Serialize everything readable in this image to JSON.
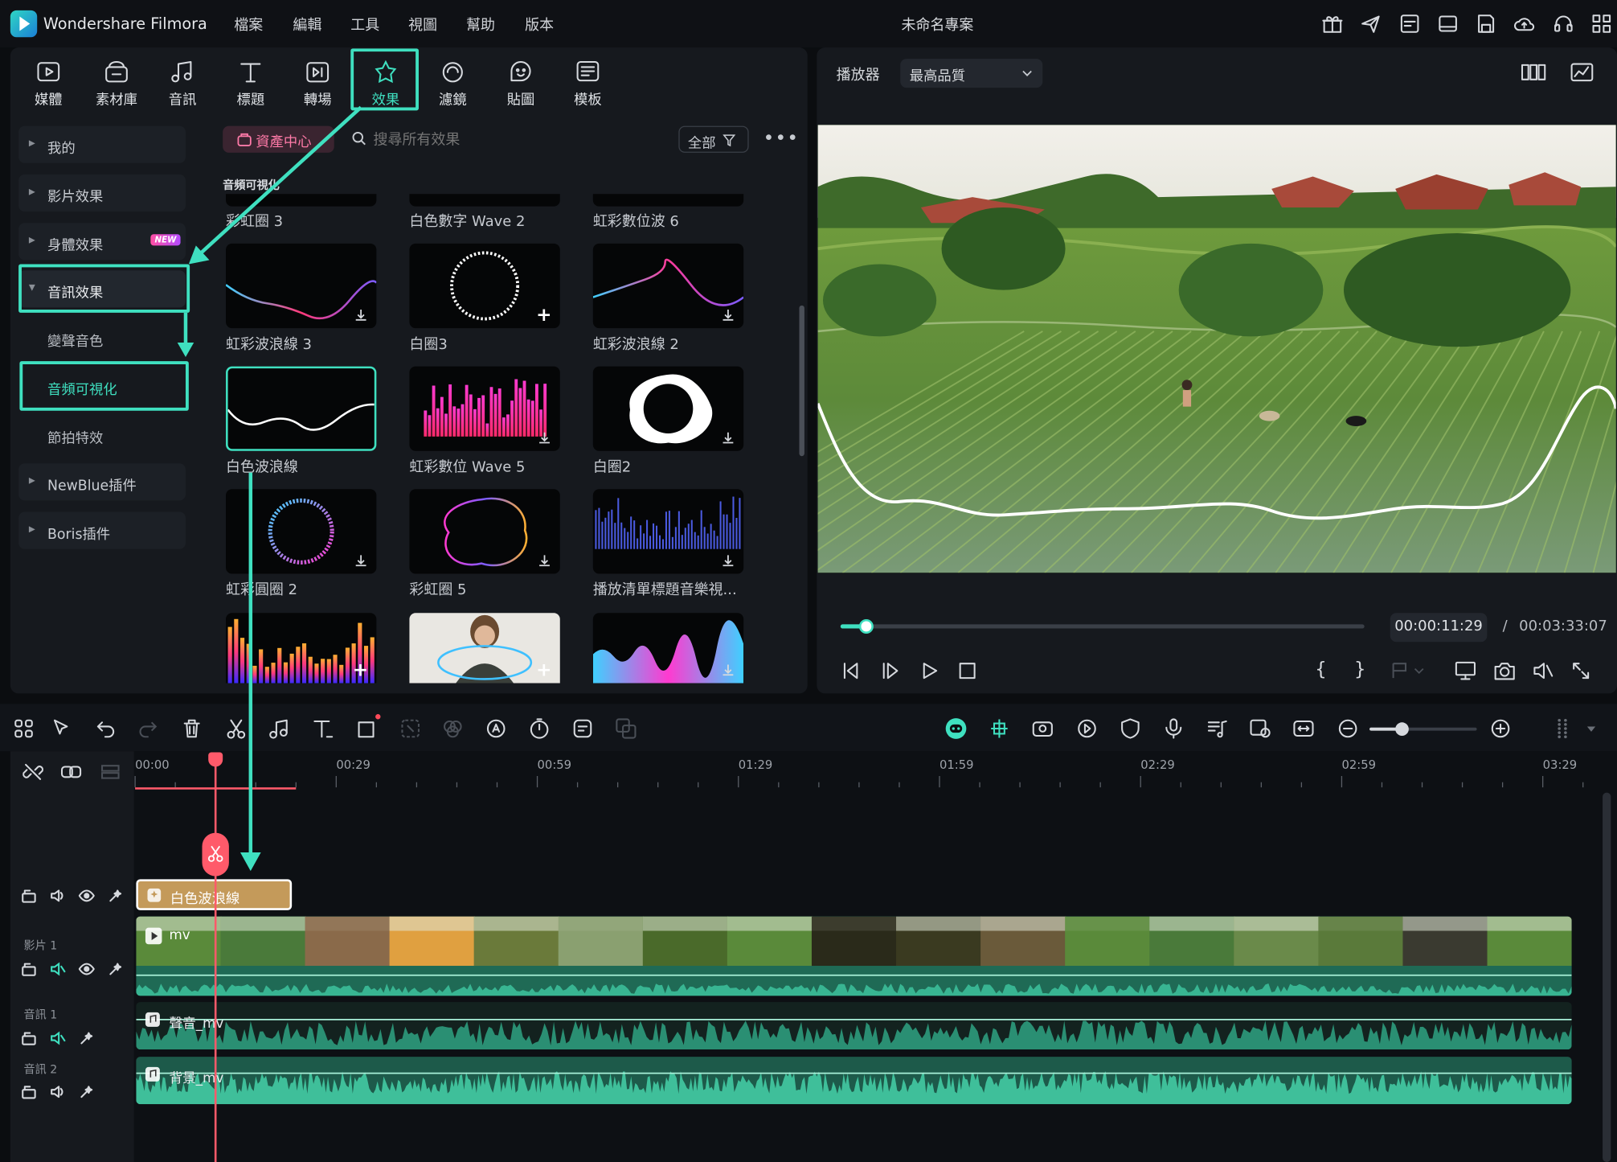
{
  "app": {
    "title": "Wondershare Filmora",
    "project": "未命名專案"
  },
  "menu": [
    "檔案",
    "編輯",
    "工具",
    "視圖",
    "幫助",
    "版本"
  ],
  "tabs": [
    {
      "label": "媒體",
      "icon": "media-icon"
    },
    {
      "label": "素材庫",
      "icon": "stock-icon"
    },
    {
      "label": "音訊",
      "icon": "music-icon"
    },
    {
      "label": "標題",
      "icon": "title-icon"
    },
    {
      "label": "轉場",
      "icon": "transition-icon"
    },
    {
      "label": "效果",
      "icon": "effects-icon",
      "active": true
    },
    {
      "label": "濾鏡",
      "icon": "filter-icon"
    },
    {
      "label": "貼圖",
      "icon": "sticker-icon"
    },
    {
      "label": "模板",
      "icon": "template-icon"
    }
  ],
  "sidebar": {
    "categories": [
      "我的",
      "影片效果",
      "身體效果",
      "音訊效果",
      "NewBlue插件",
      "Boris插件"
    ],
    "new_badge": "NEW",
    "sub_items": [
      "變聲音色",
      "音頻可視化",
      "節拍特效"
    ]
  },
  "browser": {
    "asset_center": "資產中心",
    "search_placeholder": "搜尋所有效果",
    "filter_label": "全部",
    "section_title": "音頻可視化",
    "items": [
      {
        "label": "彩虹圈 3"
      },
      {
        "label": "白色數字 Wave 2"
      },
      {
        "label": "虹彩數位波 6"
      },
      {
        "label": "虹彩波浪線 3"
      },
      {
        "label": "白圈3"
      },
      {
        "label": "虹彩波浪線 2"
      },
      {
        "label": "白色波浪線"
      },
      {
        "label": "虹彩數位 Wave 5"
      },
      {
        "label": "白圈2"
      },
      {
        "label": "虹彩圓圈 2"
      },
      {
        "label": "彩虹圈 5"
      },
      {
        "label": "播放清單標題音樂視..."
      }
    ]
  },
  "player": {
    "label": "播放器",
    "quality": "最高品質",
    "current_time": "00:00:11:29",
    "separator": "/",
    "total_time": "00:03:33:07",
    "progress": 0.05
  },
  "timeline": {
    "ruler": [
      "00:00",
      "00:29",
      "00:59",
      "01:29",
      "01:59",
      "02:29",
      "02:59",
      "03:29"
    ],
    "tracks": {
      "effect_clip": "白色波浪線",
      "video_label": "影片 1",
      "video_clip": "mv",
      "audio1_label": "音訊 1",
      "audio1_clip": "聲音_mv",
      "audio2_label": "音訊 2",
      "audio2_clip": "背景_mv"
    }
  },
  "colors": {
    "accent": "#3fe0c0",
    "playhead": "#ff5a6a",
    "audio": "#2fae8c",
    "effect_clip": "#c49a5a"
  }
}
